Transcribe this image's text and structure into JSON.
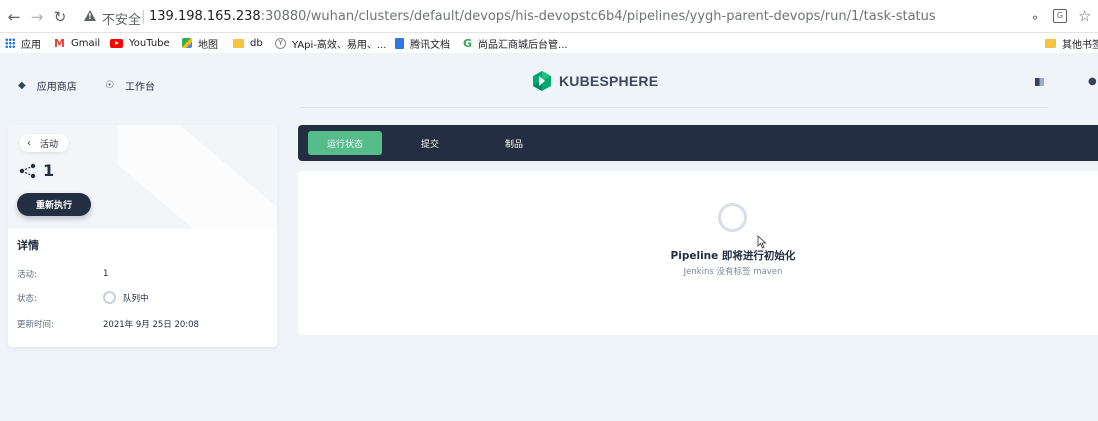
{
  "browser": {
    "insecure_label": "不安全",
    "url_host": "139.198.165.238",
    "url_rest": ":30880/wuhan/clusters/default/devops/his-devopstc6b4/pipelines/yygh-parent-devops/run/1/task-status",
    "bookmarks": [
      {
        "label": "应用",
        "icon": "apps-grid-icon"
      },
      {
        "label": "Gmail",
        "icon": "gmail-icon"
      },
      {
        "label": "YouTube",
        "icon": "youtube-icon"
      },
      {
        "label": "地图",
        "icon": "maps-icon"
      },
      {
        "label": "db",
        "icon": "folder-icon"
      },
      {
        "label": "YApi-高效、易用、...",
        "icon": "yapi-icon"
      },
      {
        "label": "腾讯文档",
        "icon": "doc-icon"
      },
      {
        "label": "尚品汇商城后台管...",
        "icon": "google-icon"
      },
      {
        "label": "其他书签",
        "icon": "folder-icon"
      }
    ]
  },
  "header": {
    "app_store": "应用商店",
    "workbench": "工作台",
    "logo_text": "KUBESPHERE"
  },
  "run": {
    "back_label": "活动",
    "run_number": "1",
    "rerun_label": "重新执行",
    "details_title": "详情",
    "details": [
      {
        "key": "活动:",
        "value": "1"
      },
      {
        "key": "状态:",
        "value": "队列中"
      },
      {
        "key": "更新时间:",
        "value": "2021年 9月 25日 20:08"
      }
    ]
  },
  "tabs": [
    {
      "label": "运行状态",
      "active": true
    },
    {
      "label": "提交",
      "active": false
    },
    {
      "label": "制品",
      "active": false
    }
  ],
  "status_panel": {
    "title": "Pipeline 即将进行初始化",
    "subtitle": "Jenkins 没有标签 maven"
  },
  "colors": {
    "accent": "#55bc8a",
    "dark": "#242e42",
    "background": "#eff4f9"
  }
}
